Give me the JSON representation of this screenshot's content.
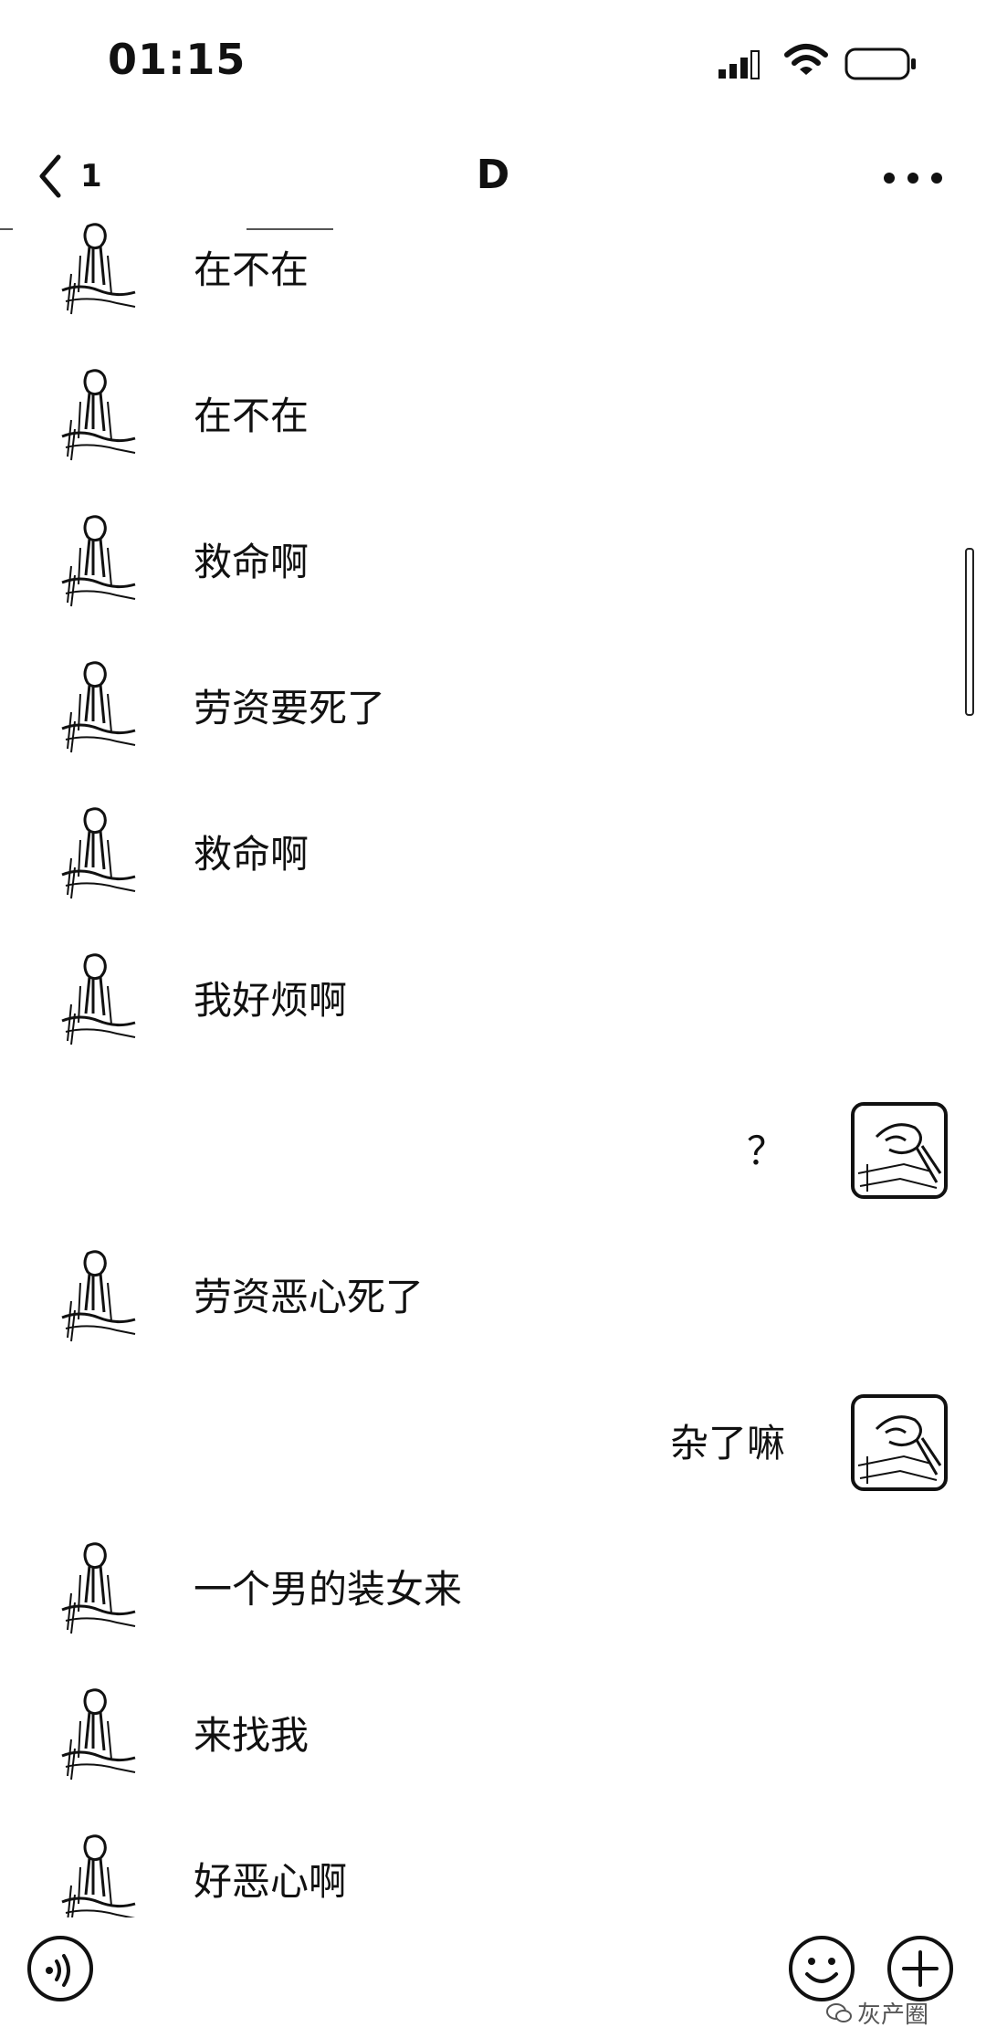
{
  "status_bar": {
    "time": "01:15"
  },
  "nav": {
    "back_count": "1",
    "title": "D"
  },
  "messages": [
    {
      "side": "in",
      "text": "在不在"
    },
    {
      "side": "in",
      "text": "在不在"
    },
    {
      "side": "in",
      "text": "救命啊"
    },
    {
      "side": "in",
      "text": "劳资要死了"
    },
    {
      "side": "in",
      "text": "救命啊"
    },
    {
      "side": "in",
      "text": "我好烦啊"
    },
    {
      "side": "out",
      "text": "？"
    },
    {
      "side": "in",
      "text": "劳资恶心死了"
    },
    {
      "side": "out",
      "text": "杂了嘛"
    },
    {
      "side": "in",
      "text": "一个男的装女来"
    },
    {
      "side": "in",
      "text": "来找我"
    },
    {
      "side": "in",
      "text": "好恶心啊"
    }
  ],
  "watermark": {
    "text": "灰产圈"
  },
  "icons": {
    "back": "chevron-left-icon",
    "more": "more-dots-icon",
    "voice": "voice-icon",
    "emoji": "emoji-icon",
    "plus": "plus-icon"
  }
}
